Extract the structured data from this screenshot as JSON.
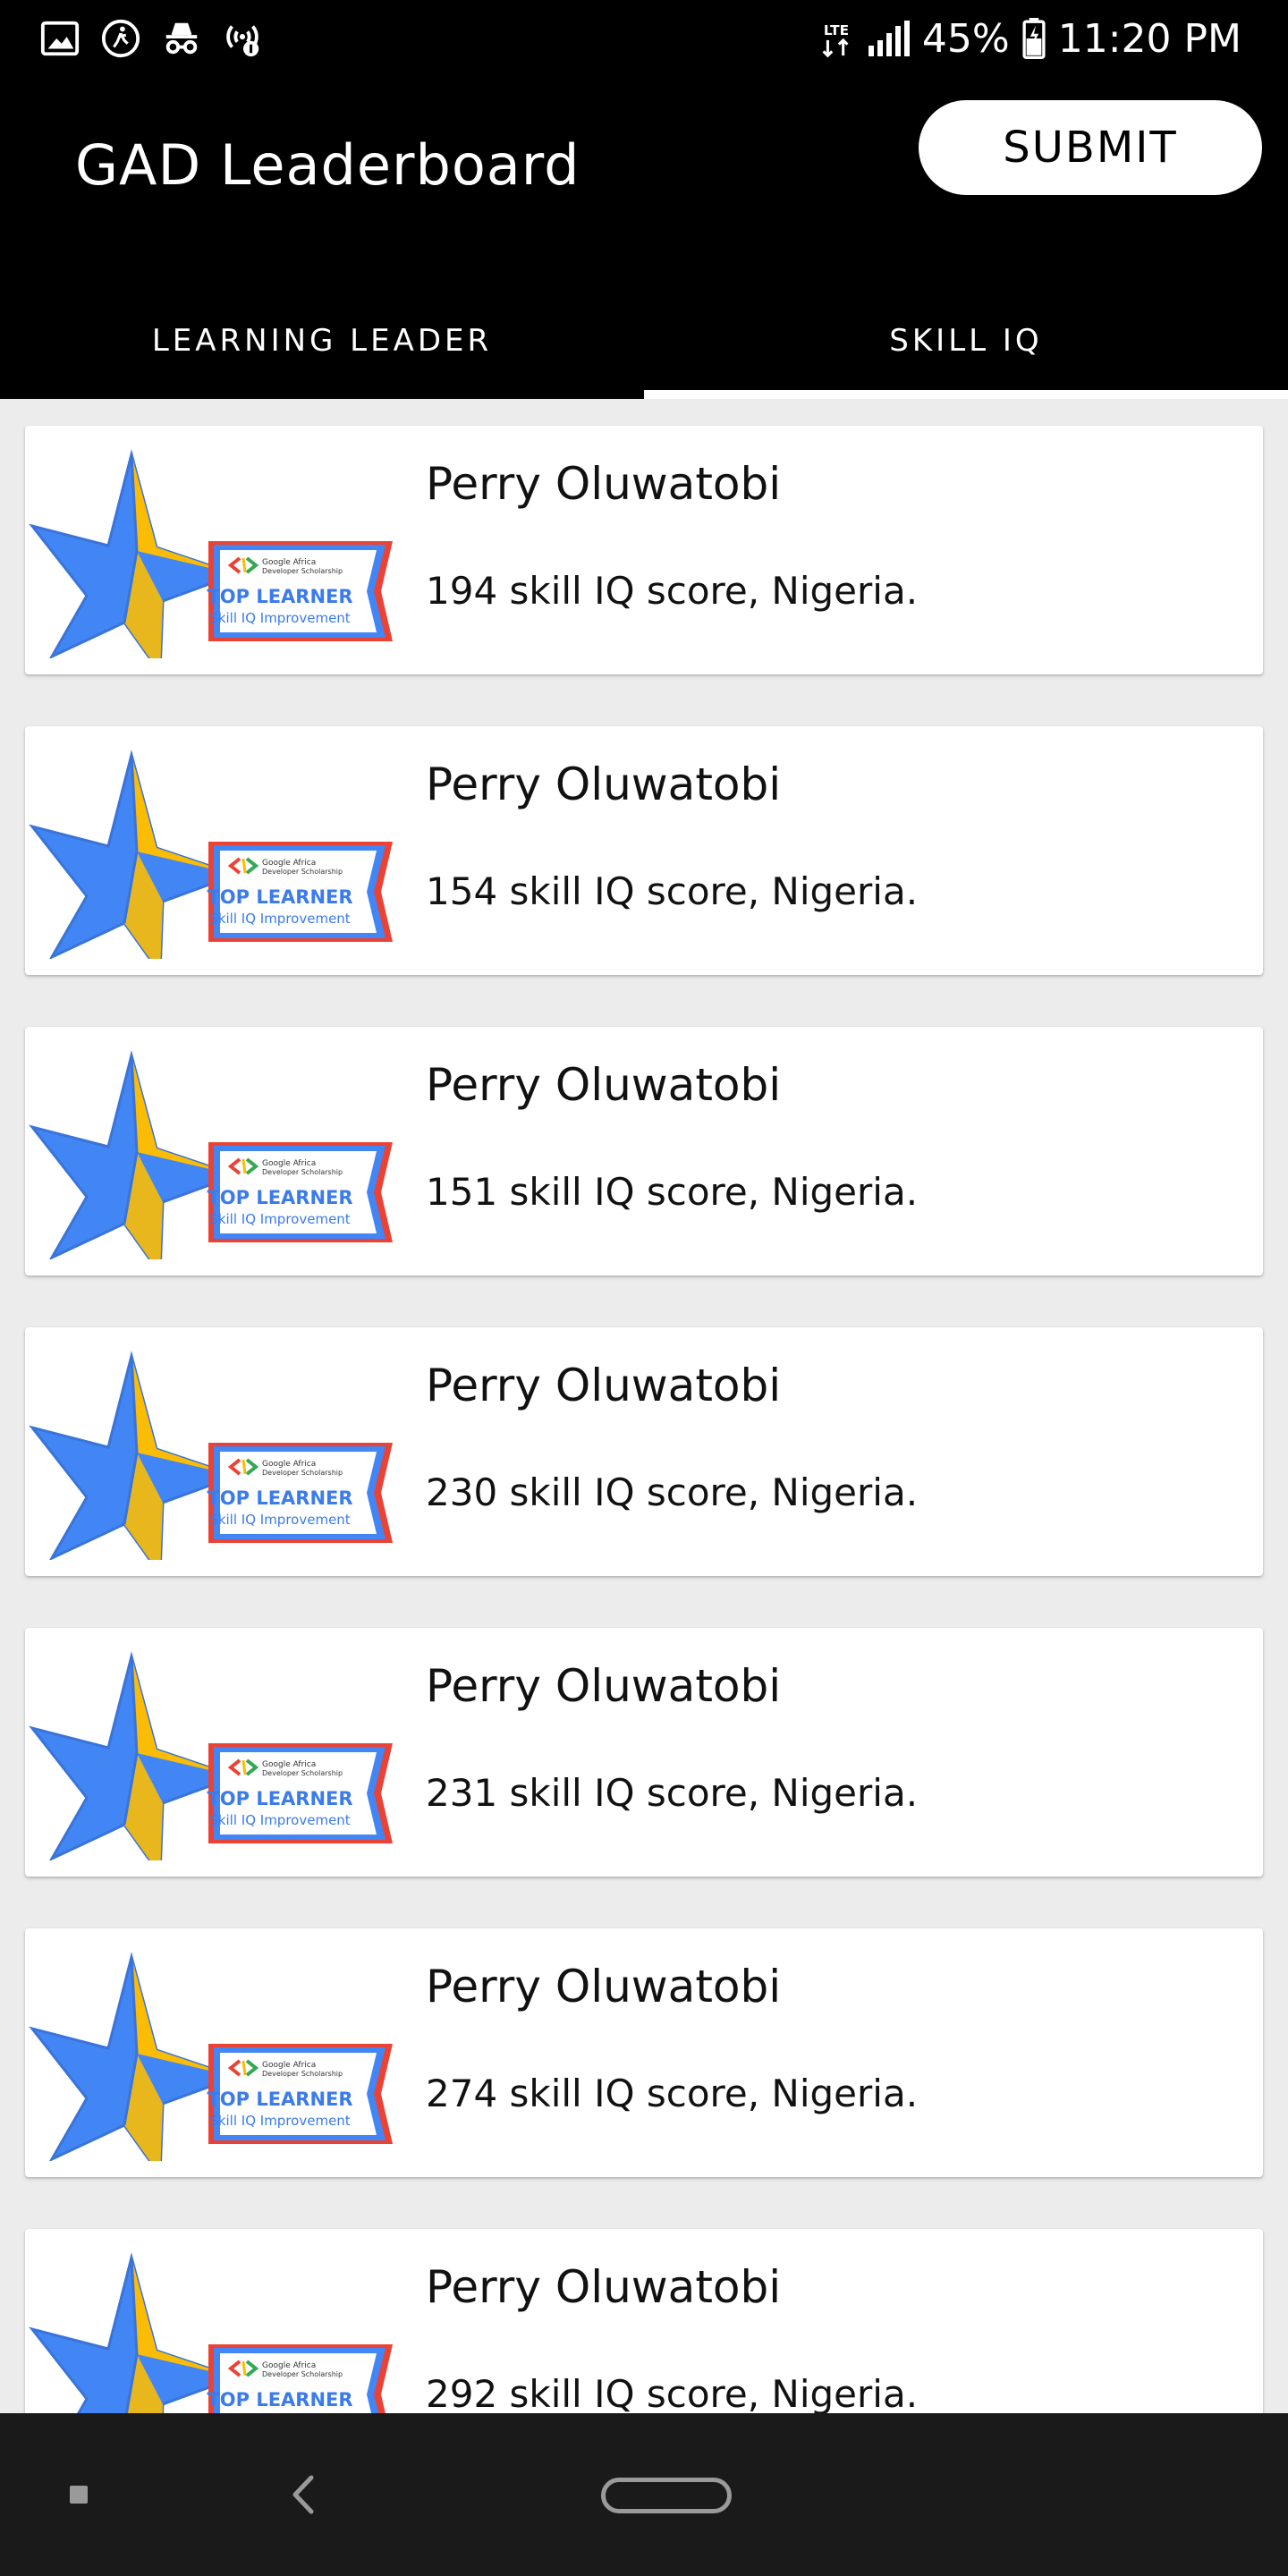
{
  "status_bar": {
    "network_label": "LTE",
    "battery": "45%",
    "time": "11:20 PM"
  },
  "app_bar": {
    "title": "GAD Leaderboard",
    "submit_label": "SUBMIT"
  },
  "tabs": [
    {
      "label": "LEARNING LEADER",
      "selected": false
    },
    {
      "label": "SKILL IQ",
      "selected": true
    }
  ],
  "badge": {
    "org_line1": "Google Africa",
    "org_line2": "Developer Scholarship",
    "title": "TOP LEARNER",
    "subtitle": "Skill IQ Improvement"
  },
  "learners": [
    {
      "name": "Perry Oluwatobi",
      "score_text": "194 skill IQ score, Nigeria."
    },
    {
      "name": "Perry Oluwatobi",
      "score_text": "154 skill IQ score, Nigeria."
    },
    {
      "name": "Perry Oluwatobi",
      "score_text": "151 skill IQ score, Nigeria."
    },
    {
      "name": "Perry Oluwatobi",
      "score_text": "230 skill IQ score, Nigeria."
    },
    {
      "name": "Perry Oluwatobi",
      "score_text": "231 skill IQ score, Nigeria."
    },
    {
      "name": "Perry Oluwatobi",
      "score_text": "274 skill IQ score, Nigeria."
    },
    {
      "name": "Perry Oluwatobi",
      "score_text": "292 skill IQ score, Nigeria."
    }
  ],
  "colors": {
    "star_blue": "#4285f4",
    "star_yellow": "#fbbc05",
    "ribbon_red": "#ea4335",
    "ribbon_text_blue": "#3b7bea"
  }
}
